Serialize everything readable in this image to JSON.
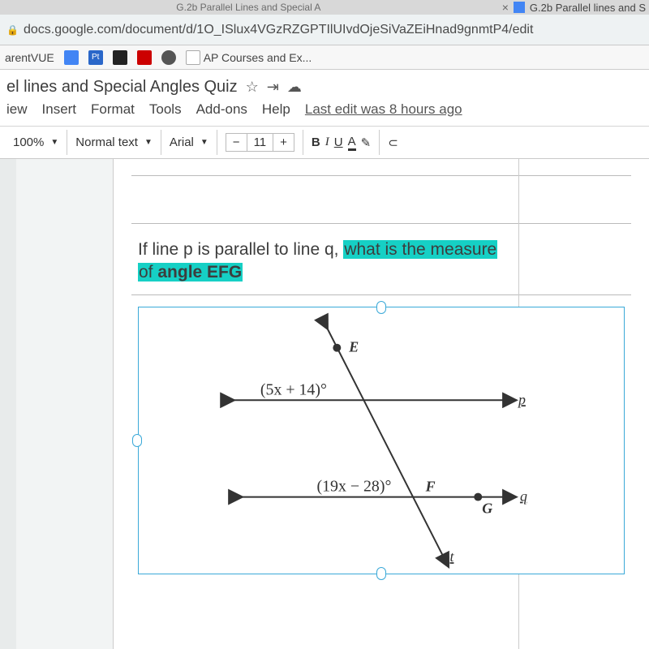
{
  "tabs": {
    "left_title": "G.2b Parallel Lines and Special A",
    "right_title": "G.2b Parallel lines and S"
  },
  "address": {
    "url": "docs.google.com/document/d/1O_ISlux4VGzRZGPTIlUIvdOjeSiVaZEiHnad9gnmtP4/edit"
  },
  "bookmarks": {
    "b1": "arentVUE",
    "b2": "Pt",
    "ap": "AP Courses and Ex..."
  },
  "doc": {
    "title": "el lines and Special Angles Quiz",
    "menus": {
      "view": "iew",
      "insert": "Insert",
      "format": "Format",
      "tools": "Tools",
      "addons": "Add-ons",
      "help": "Help",
      "last_edit": "Last edit was 8 hours ago"
    },
    "toolbar": {
      "zoom": "100%",
      "style": "Normal text",
      "font": "Arial",
      "minus": "−",
      "size": "11",
      "plus": "+",
      "bold": "B",
      "italic": "I",
      "underline": "U",
      "textcolor": "A"
    },
    "question": {
      "p1": "If line p is parallel to line q, ",
      "h1": "what is the measure",
      "h2_pre": "of ",
      "h2_bold": "angle EFG"
    },
    "diagram": {
      "E": "E",
      "F": "F",
      "G": "G",
      "p": "p",
      "q": "q",
      "t": "t",
      "expr1": "(5x + 14)°",
      "expr2": "(19x − 28)°"
    }
  }
}
